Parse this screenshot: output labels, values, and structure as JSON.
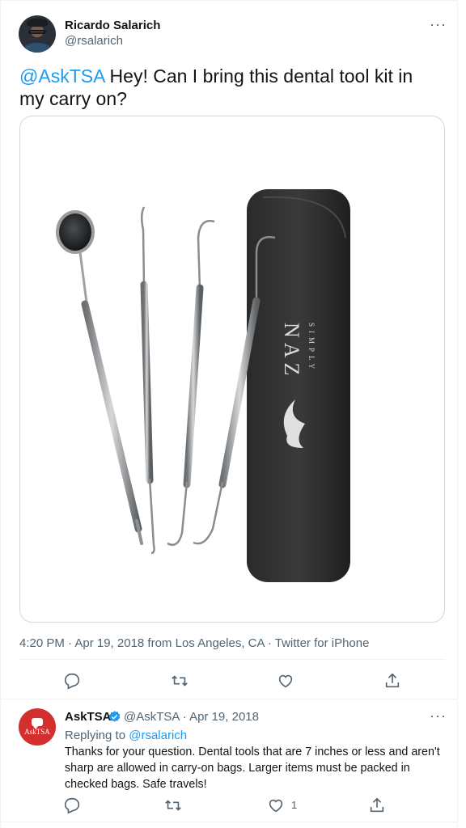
{
  "main_tweet": {
    "author_name": "Ricardo Salarich",
    "author_handle": "@rsalarich",
    "more_label": "···",
    "text_mention": "@AskTSA",
    "text_body": " Hey! Can I bring this dental tool kit in my carry on?",
    "image": {
      "description_brand_small": "SIMPLY",
      "description_brand_large": "NAZ"
    },
    "meta": "4:20 PM · Apr 19, 2018 from Los Angeles, CA · Twitter for iPhone",
    "actions": [
      "reply-icon",
      "retweet-icon",
      "like-icon",
      "share-icon"
    ]
  },
  "reply_tweet": {
    "avatar_label": "AskTSA",
    "author_name": "AskTSA",
    "author_handle_date": "@AskTSA · Apr 19, 2018",
    "more_label": "···",
    "replying_prefix": "Replying to ",
    "replying_handle": "@rsalarich",
    "text": "Thanks for your question. Dental tools that are 7 inches or less and aren't sharp are allowed in carry-on bags. Larger items must be packed in checked bags. Safe travels!",
    "like_count": "1",
    "actions": [
      "reply-icon",
      "retweet-icon",
      "like-icon",
      "share-icon"
    ]
  },
  "colors": {
    "accent": "#1d9bf0",
    "secondary_text": "#536471",
    "border": "#cfd9de",
    "tsa_red": "#d32f2f"
  }
}
